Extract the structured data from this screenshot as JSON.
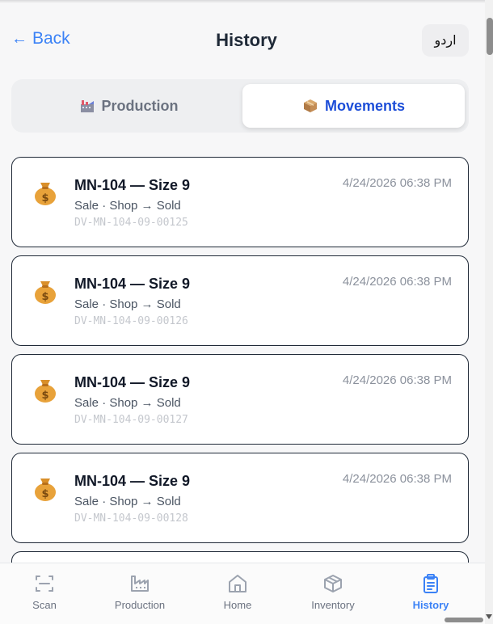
{
  "header": {
    "back_label": "Back",
    "back_arrow": "←",
    "title": "History",
    "language_label": "اردو"
  },
  "tabs": {
    "production": {
      "label": "Production",
      "icon": "factory-icon"
    },
    "movements": {
      "label": "Movements",
      "icon": "package-icon",
      "active": true
    }
  },
  "movements": [
    {
      "title": "MN-104 — Size 9",
      "detail": "Sale · Shop → Sold",
      "code": "DV-MN-104-09-00125",
      "time": "4/24/2026 06:38 PM",
      "icon": "money-bag-icon"
    },
    {
      "title": "MN-104 — Size 9",
      "detail": "Sale · Shop → Sold",
      "code": "DV-MN-104-09-00126",
      "time": "4/24/2026 06:38 PM",
      "icon": "money-bag-icon"
    },
    {
      "title": "MN-104 — Size 9",
      "detail": "Sale · Shop → Sold",
      "code": "DV-MN-104-09-00127",
      "time": "4/24/2026 06:38 PM",
      "icon": "money-bag-icon"
    },
    {
      "title": "MN-104 — Size 9",
      "detail": "Sale · Shop → Sold",
      "code": "DV-MN-104-09-00128",
      "time": "4/24/2026 06:38 PM",
      "icon": "money-bag-icon"
    }
  ],
  "nav": [
    {
      "label": "Scan",
      "icon": "scan-icon"
    },
    {
      "label": "Production",
      "icon": "factory-icon"
    },
    {
      "label": "Home",
      "icon": "home-icon"
    },
    {
      "label": "Inventory",
      "icon": "box-icon"
    },
    {
      "label": "History",
      "icon": "clipboard-icon",
      "active": true
    }
  ],
  "colors": {
    "accent": "#3b82f6",
    "active_tab_text": "#1d4ed8",
    "muted": "#6b7280"
  }
}
